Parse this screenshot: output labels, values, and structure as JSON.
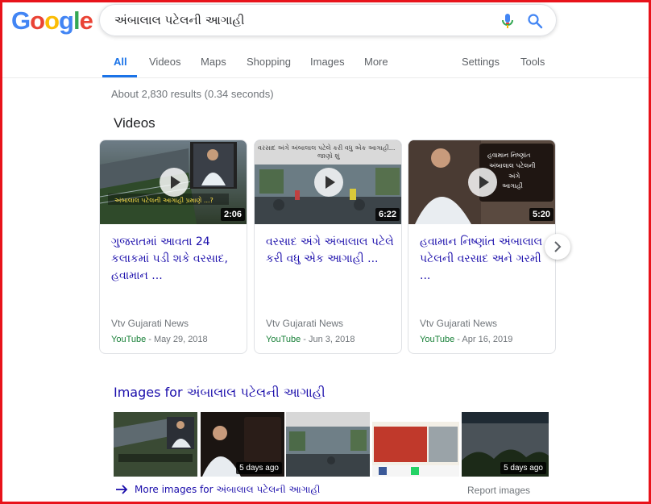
{
  "logo": {
    "letters": [
      "G",
      "o",
      "o",
      "g",
      "l",
      "e"
    ],
    "colors": [
      "#4285F4",
      "#EA4335",
      "#FBBC05",
      "#4285F4",
      "#34A853",
      "#EA4335"
    ]
  },
  "search": {
    "query": "અંબાલાલ પટેલની આગાહી"
  },
  "tabs": {
    "all": "All",
    "videos": "Videos",
    "maps": "Maps",
    "shopping": "Shopping",
    "images": "Images",
    "more": "More",
    "settings": "Settings",
    "tools": "Tools"
  },
  "result_stats": "About 2,830 results (0.34 seconds)",
  "videos_heading": "Videos",
  "videos": [
    {
      "title": "ગુજરાતમાં આવતા 24 કલાકમાં પડી શકે વરસાદ, હવામાન ...",
      "channel": "Vtv Gujarati News",
      "source": "YouTube",
      "date": " - May 29, 2018",
      "duration": "2:06",
      "thumb_caption": "અંબાલાલ પટેલની આગાહી પ્રમાણે ...?"
    },
    {
      "title": "વરસાદ અંગે અંબાલાલ પટેલે કરી વધુ એક આગાહી ...",
      "channel": "Vtv Gujarati News",
      "source": "YouTube",
      "date": " - Jun 3, 2018",
      "duration": "6:22",
      "thumb_caption": "વરસાદ અંગે અંબાલાલ પટેલે કરી વધુ એક આગાહી...",
      "thumb_caption2": "જાણો શું"
    },
    {
      "title": "હવામાન નિષ્ણાંત અંબાલાલ પટેલની વરસાદ અને ગરમી ...",
      "channel": "Vtv Gujarati News",
      "source": "YouTube",
      "date": " - Apr 16, 2019",
      "duration": "5:20",
      "thumb_caption": "હવામાન નિષ્ણાંત",
      "thumb_caption2": "અંબાલાલ પટેલની",
      "thumb_caption3": "અંગે",
      "thumb_caption4": "આગાહી"
    }
  ],
  "images_heading": "Images for અંબાલાલ પટેલની આગાહી",
  "images": [
    {
      "badge": ""
    },
    {
      "badge": "5 days ago"
    },
    {
      "badge": ""
    },
    {
      "badge": ""
    },
    {
      "badge": "5 days ago"
    }
  ],
  "more_images": "More images for અંબાલાલ પટેલની આગાહી",
  "report_images": "Report images"
}
